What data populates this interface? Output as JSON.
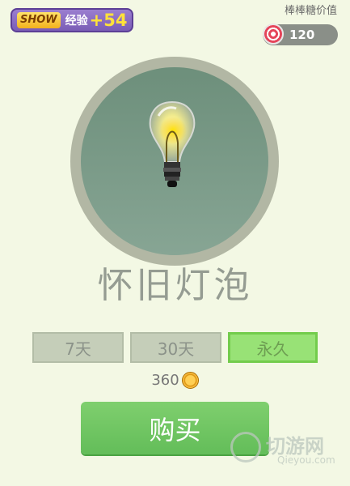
{
  "badge": {
    "show_label": "SHOW",
    "exp_label": "经验",
    "exp_value": "+54"
  },
  "currency": {
    "label": "棒棒糖价值",
    "amount": "120"
  },
  "item": {
    "title": "怀旧灯泡"
  },
  "options": [
    {
      "label": "7天",
      "selected": false
    },
    {
      "label": "30天",
      "selected": false
    },
    {
      "label": "永久",
      "selected": true
    }
  ],
  "price": {
    "amount": "360"
  },
  "buy_label": "购买",
  "watermark": {
    "title": "切游网",
    "domain": "Qieyou.com"
  },
  "icons": {
    "badge": "show-logo",
    "currency": "lollipop-icon",
    "item": "light-bulb-icon",
    "price": "coin-icon"
  }
}
